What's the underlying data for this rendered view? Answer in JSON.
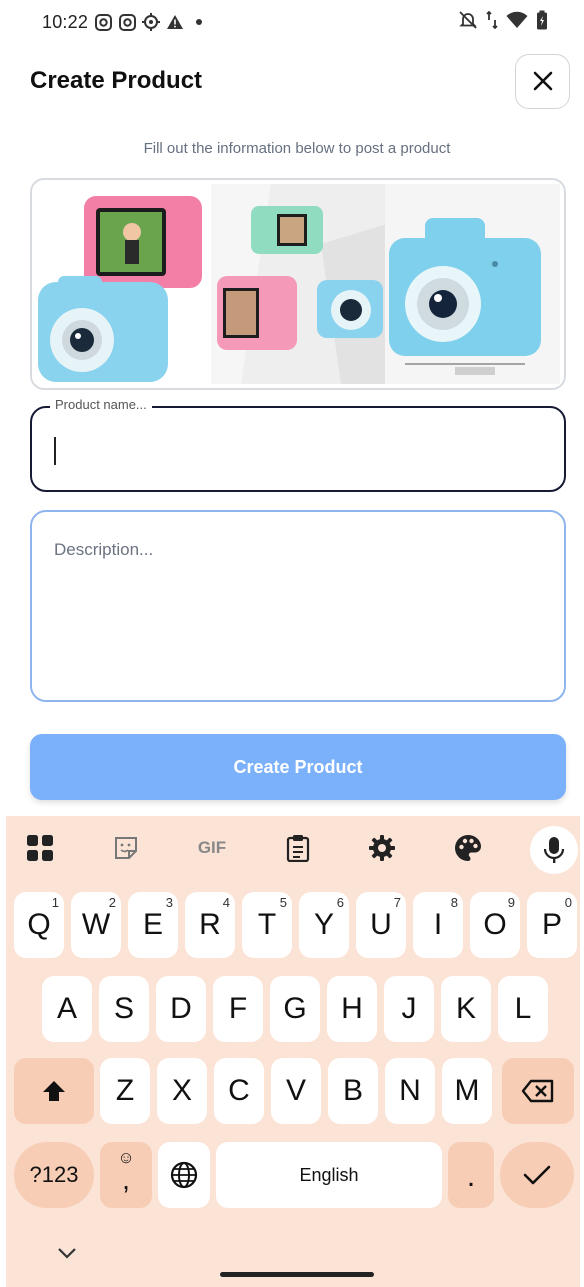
{
  "status": {
    "time": "10:22"
  },
  "header": {
    "title": "Create Product"
  },
  "form": {
    "subtitle": "Fill out the information below to post a product",
    "name_label": "Product name...",
    "description_placeholder": "Description...",
    "submit_label": "Create Product"
  },
  "keyboard": {
    "toolbar": {
      "gif": "GIF"
    },
    "row1": [
      {
        "k": "Q",
        "h": "1"
      },
      {
        "k": "W",
        "h": "2"
      },
      {
        "k": "E",
        "h": "3"
      },
      {
        "k": "R",
        "h": "4"
      },
      {
        "k": "T",
        "h": "5"
      },
      {
        "k": "Y",
        "h": "6"
      },
      {
        "k": "U",
        "h": "7"
      },
      {
        "k": "I",
        "h": "8"
      },
      {
        "k": "O",
        "h": "9"
      },
      {
        "k": "P",
        "h": "0"
      }
    ],
    "row2": [
      "A",
      "S",
      "D",
      "F",
      "G",
      "H",
      "J",
      "K",
      "L"
    ],
    "row3": [
      "Z",
      "X",
      "C",
      "V",
      "B",
      "N",
      "M"
    ],
    "symbols": "?123",
    "space": "English",
    "period": ".",
    "comma": ","
  },
  "colors": {
    "accent": "#7bb0fb",
    "keyboard_bg": "#fbe3d6",
    "key_dark": "#f7cdb6"
  },
  "icons": [
    "instagram-icon",
    "instagram-icon",
    "settings-icon",
    "warning-icon",
    "dot-icon",
    "bell-off-icon",
    "data-icon",
    "wifi-icon",
    "battery-icon",
    "close-icon",
    "apps-icon",
    "sticker-icon",
    "clipboard-icon",
    "gear-icon",
    "palette-icon",
    "mic-icon",
    "shift-icon",
    "backspace-icon",
    "emoji-icon",
    "globe-icon",
    "check-icon",
    "chevron-down-icon"
  ]
}
